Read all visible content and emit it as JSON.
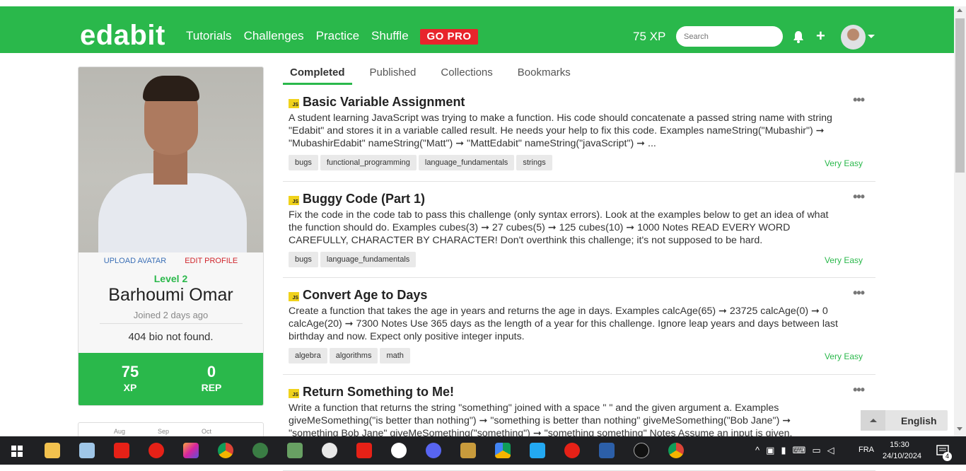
{
  "navbar": {
    "brand": "edabit",
    "links": [
      "Tutorials",
      "Challenges",
      "Practice",
      "Shuffle"
    ],
    "go_pro": "GO PRO",
    "xp": "75 XP",
    "search_placeholder": "Search",
    "color": "#2ab84b"
  },
  "profile": {
    "upload_avatar": "UPLOAD AVATAR",
    "edit_profile": "EDIT PROFILE",
    "level": "Level 2",
    "name": "Barhoumi Omar",
    "joined": "Joined 2 days ago",
    "bio": "404 bio not found.",
    "xp_value": "75",
    "xp_label": "XP",
    "rep_value": "0",
    "rep_label": "REP",
    "calendar_months": [
      "Aug",
      "Sep",
      "Oct"
    ]
  },
  "tabs": [
    "Completed",
    "Published",
    "Collections",
    "Bookmarks"
  ],
  "challenges": [
    {
      "lang": "JS",
      "title": "Basic Variable Assignment",
      "description": "A student learning JavaScript was trying to make a function. His code should concatenate a passed string name with string \"Edabit\" and stores it in a variable called result. He needs your help to fix this code. Examples nameString(\"Mubashir\") ➞ \"MubashirEdabit\" nameString(\"Matt\") ➞ \"MattEdabit\" nameString(\"javaScript\") ➞ ...",
      "tags": [
        "bugs",
        "functional_programming",
        "language_fundamentals",
        "strings"
      ],
      "difficulty": "Very Easy"
    },
    {
      "lang": "JS",
      "title": "Buggy Code (Part 1)",
      "description": "Fix the code in the code tab to pass this challenge (only syntax errors). Look at the examples below to get an idea of what the function should do. Examples cubes(3) ➞ 27 cubes(5) ➞ 125 cubes(10) ➞ 1000 Notes READ EVERY WORD CAREFULLY, CHARACTER BY CHARACTER! Don't overthink this challenge; it's not supposed to be hard.",
      "tags": [
        "bugs",
        "language_fundamentals"
      ],
      "difficulty": "Very Easy"
    },
    {
      "lang": "JS",
      "title": "Convert Age to Days",
      "description": "Create a function that takes the age in years and returns the age in days. Examples calcAge(65) ➞ 23725 calcAge(0) ➞ 0 calcAge(20) ➞ 7300 Notes Use 365 days as the length of a year for this challenge. Ignore leap years and days between last birthday and now. Expect only positive integer inputs.",
      "tags": [
        "algebra",
        "algorithms",
        "math"
      ],
      "difficulty": "Very Easy"
    },
    {
      "lang": "JS",
      "title": "Return Something to Me!",
      "description": "Write a function that returns the string \"something\" joined with a space \" \" and the given argument a. Examples giveMeSomething(\"is better than nothing\") ➞ \"something is better than nothing\" giveMeSomething(\"Bob Jane\") ➞ \"something Bob Jane\" giveMeSomething(\"something\") ➞ \"something something\" Notes Assume an input is given.",
      "tags": [],
      "difficulty": ""
    }
  ],
  "language_button": "English",
  "taskbar": {
    "language": "FRA",
    "time": "15:30",
    "date": "24/10/2024",
    "notifications": "4"
  }
}
